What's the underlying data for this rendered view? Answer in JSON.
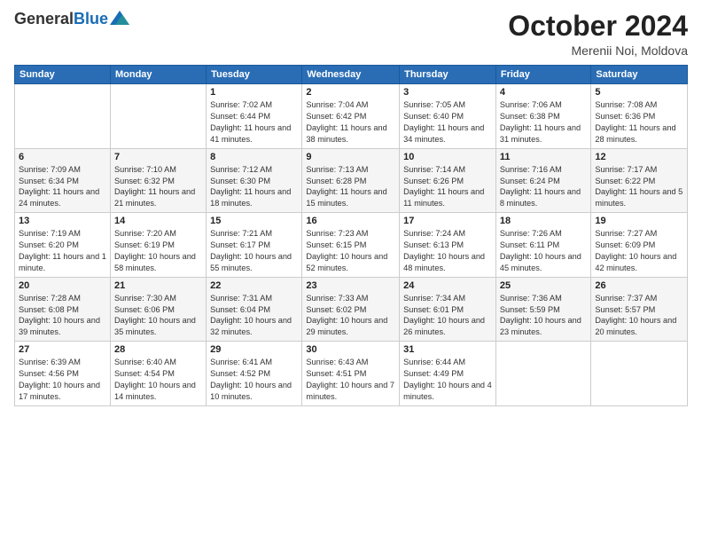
{
  "header": {
    "logo_general": "General",
    "logo_blue": "Blue",
    "month": "October 2024",
    "location": "Merenii Noi, Moldova"
  },
  "weekdays": [
    "Sunday",
    "Monday",
    "Tuesday",
    "Wednesday",
    "Thursday",
    "Friday",
    "Saturday"
  ],
  "weeks": [
    [
      {
        "day": "",
        "info": ""
      },
      {
        "day": "",
        "info": ""
      },
      {
        "day": "1",
        "info": "Sunrise: 7:02 AM\nSunset: 6:44 PM\nDaylight: 11 hours and 41 minutes."
      },
      {
        "day": "2",
        "info": "Sunrise: 7:04 AM\nSunset: 6:42 PM\nDaylight: 11 hours and 38 minutes."
      },
      {
        "day": "3",
        "info": "Sunrise: 7:05 AM\nSunset: 6:40 PM\nDaylight: 11 hours and 34 minutes."
      },
      {
        "day": "4",
        "info": "Sunrise: 7:06 AM\nSunset: 6:38 PM\nDaylight: 11 hours and 31 minutes."
      },
      {
        "day": "5",
        "info": "Sunrise: 7:08 AM\nSunset: 6:36 PM\nDaylight: 11 hours and 28 minutes."
      }
    ],
    [
      {
        "day": "6",
        "info": "Sunrise: 7:09 AM\nSunset: 6:34 PM\nDaylight: 11 hours and 24 minutes."
      },
      {
        "day": "7",
        "info": "Sunrise: 7:10 AM\nSunset: 6:32 PM\nDaylight: 11 hours and 21 minutes."
      },
      {
        "day": "8",
        "info": "Sunrise: 7:12 AM\nSunset: 6:30 PM\nDaylight: 11 hours and 18 minutes."
      },
      {
        "day": "9",
        "info": "Sunrise: 7:13 AM\nSunset: 6:28 PM\nDaylight: 11 hours and 15 minutes."
      },
      {
        "day": "10",
        "info": "Sunrise: 7:14 AM\nSunset: 6:26 PM\nDaylight: 11 hours and 11 minutes."
      },
      {
        "day": "11",
        "info": "Sunrise: 7:16 AM\nSunset: 6:24 PM\nDaylight: 11 hours and 8 minutes."
      },
      {
        "day": "12",
        "info": "Sunrise: 7:17 AM\nSunset: 6:22 PM\nDaylight: 11 hours and 5 minutes."
      }
    ],
    [
      {
        "day": "13",
        "info": "Sunrise: 7:19 AM\nSunset: 6:20 PM\nDaylight: 11 hours and 1 minute."
      },
      {
        "day": "14",
        "info": "Sunrise: 7:20 AM\nSunset: 6:19 PM\nDaylight: 10 hours and 58 minutes."
      },
      {
        "day": "15",
        "info": "Sunrise: 7:21 AM\nSunset: 6:17 PM\nDaylight: 10 hours and 55 minutes."
      },
      {
        "day": "16",
        "info": "Sunrise: 7:23 AM\nSunset: 6:15 PM\nDaylight: 10 hours and 52 minutes."
      },
      {
        "day": "17",
        "info": "Sunrise: 7:24 AM\nSunset: 6:13 PM\nDaylight: 10 hours and 48 minutes."
      },
      {
        "day": "18",
        "info": "Sunrise: 7:26 AM\nSunset: 6:11 PM\nDaylight: 10 hours and 45 minutes."
      },
      {
        "day": "19",
        "info": "Sunrise: 7:27 AM\nSunset: 6:09 PM\nDaylight: 10 hours and 42 minutes."
      }
    ],
    [
      {
        "day": "20",
        "info": "Sunrise: 7:28 AM\nSunset: 6:08 PM\nDaylight: 10 hours and 39 minutes."
      },
      {
        "day": "21",
        "info": "Sunrise: 7:30 AM\nSunset: 6:06 PM\nDaylight: 10 hours and 35 minutes."
      },
      {
        "day": "22",
        "info": "Sunrise: 7:31 AM\nSunset: 6:04 PM\nDaylight: 10 hours and 32 minutes."
      },
      {
        "day": "23",
        "info": "Sunrise: 7:33 AM\nSunset: 6:02 PM\nDaylight: 10 hours and 29 minutes."
      },
      {
        "day": "24",
        "info": "Sunrise: 7:34 AM\nSunset: 6:01 PM\nDaylight: 10 hours and 26 minutes."
      },
      {
        "day": "25",
        "info": "Sunrise: 7:36 AM\nSunset: 5:59 PM\nDaylight: 10 hours and 23 minutes."
      },
      {
        "day": "26",
        "info": "Sunrise: 7:37 AM\nSunset: 5:57 PM\nDaylight: 10 hours and 20 minutes."
      }
    ],
    [
      {
        "day": "27",
        "info": "Sunrise: 6:39 AM\nSunset: 4:56 PM\nDaylight: 10 hours and 17 minutes."
      },
      {
        "day": "28",
        "info": "Sunrise: 6:40 AM\nSunset: 4:54 PM\nDaylight: 10 hours and 14 minutes."
      },
      {
        "day": "29",
        "info": "Sunrise: 6:41 AM\nSunset: 4:52 PM\nDaylight: 10 hours and 10 minutes."
      },
      {
        "day": "30",
        "info": "Sunrise: 6:43 AM\nSunset: 4:51 PM\nDaylight: 10 hours and 7 minutes."
      },
      {
        "day": "31",
        "info": "Sunrise: 6:44 AM\nSunset: 4:49 PM\nDaylight: 10 hours and 4 minutes."
      },
      {
        "day": "",
        "info": ""
      },
      {
        "day": "",
        "info": ""
      }
    ]
  ]
}
